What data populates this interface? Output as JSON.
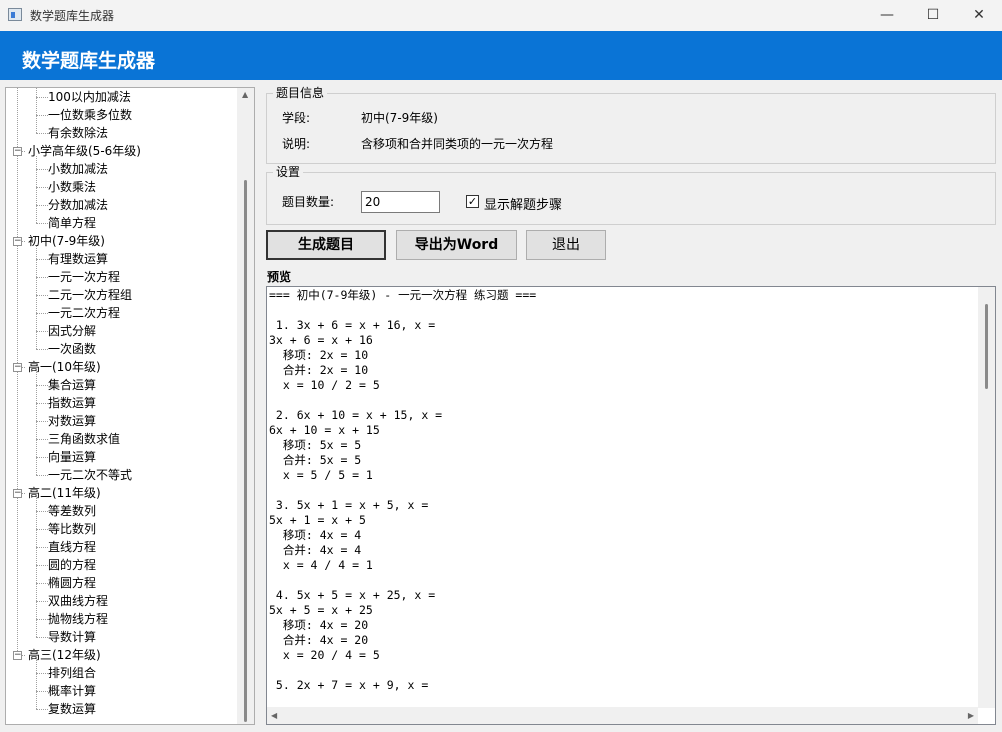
{
  "window": {
    "title": "数学题库生成器",
    "min": "—",
    "max": "☐",
    "close": "✕"
  },
  "header": {
    "title": "数学题库生成器"
  },
  "tree": [
    {
      "label": "100以内加减法",
      "level": 1
    },
    {
      "label": "一位数乘多位数",
      "level": 1
    },
    {
      "label": "有余数除法",
      "level": 1
    },
    {
      "label": "小学高年级(5-6年级)",
      "level": 0
    },
    {
      "label": "小数加减法",
      "level": 1
    },
    {
      "label": "小数乘法",
      "level": 1
    },
    {
      "label": "分数加减法",
      "level": 1
    },
    {
      "label": "简单方程",
      "level": 1
    },
    {
      "label": "初中(7-9年级)",
      "level": 0
    },
    {
      "label": "有理数运算",
      "level": 1
    },
    {
      "label": "一元一次方程",
      "level": 1
    },
    {
      "label": "二元一次方程组",
      "level": 1
    },
    {
      "label": "一元二次方程",
      "level": 1
    },
    {
      "label": "因式分解",
      "level": 1
    },
    {
      "label": "一次函数",
      "level": 1
    },
    {
      "label": "高一(10年级)",
      "level": 0
    },
    {
      "label": "集合运算",
      "level": 1
    },
    {
      "label": "指数运算",
      "level": 1
    },
    {
      "label": "对数运算",
      "level": 1
    },
    {
      "label": "三角函数求值",
      "level": 1
    },
    {
      "label": "向量运算",
      "level": 1
    },
    {
      "label": "一元二次不等式",
      "level": 1
    },
    {
      "label": "高二(11年级)",
      "level": 0
    },
    {
      "label": "等差数列",
      "level": 1
    },
    {
      "label": "等比数列",
      "level": 1
    },
    {
      "label": "直线方程",
      "level": 1
    },
    {
      "label": "圆的方程",
      "level": 1
    },
    {
      "label": "椭圆方程",
      "level": 1
    },
    {
      "label": "双曲线方程",
      "level": 1
    },
    {
      "label": "抛物线方程",
      "level": 1
    },
    {
      "label": "导数计算",
      "level": 1
    },
    {
      "label": "高三(12年级)",
      "level": 0
    },
    {
      "label": "排列组合",
      "level": 1
    },
    {
      "label": "概率计算",
      "level": 1
    },
    {
      "label": "复数运算",
      "level": 1
    }
  ],
  "info": {
    "legend": "题目信息",
    "stage_label": "学段:",
    "stage_value": "初中(7-9年级)",
    "desc_label": "说明:",
    "desc_value": "含移项和合并同类项的一元一次方程"
  },
  "settings": {
    "legend": "设置",
    "count_label": "题目数量:",
    "count_value": "20",
    "show_steps_checked": true,
    "show_steps_label": "显示解题步骤"
  },
  "buttons": {
    "generate": "生成题目",
    "export": "导出为Word",
    "exit": "退出"
  },
  "preview": {
    "label": "预览",
    "text": "=== 初中(7-9年级) - 一元一次方程 练习题 ===\n\n 1. 3x + 6 = x + 16, x =\n3x + 6 = x + 16\n  移项: 2x = 10\n  合并: 2x = 10\n  x = 10 / 2 = 5\n\n 2. 6x + 10 = x + 15, x =\n6x + 10 = x + 15\n  移项: 5x = 5\n  合并: 5x = 5\n  x = 5 / 5 = 1\n\n 3. 5x + 1 = x + 5, x =\n5x + 1 = x + 5\n  移项: 4x = 4\n  合并: 4x = 4\n  x = 4 / 4 = 1\n\n 4. 5x + 5 = x + 25, x =\n5x + 5 = x + 25\n  移项: 4x = 20\n  合并: 4x = 20\n  x = 20 / 4 = 5\n\n 5. 2x + 7 = x + 9, x ="
  }
}
